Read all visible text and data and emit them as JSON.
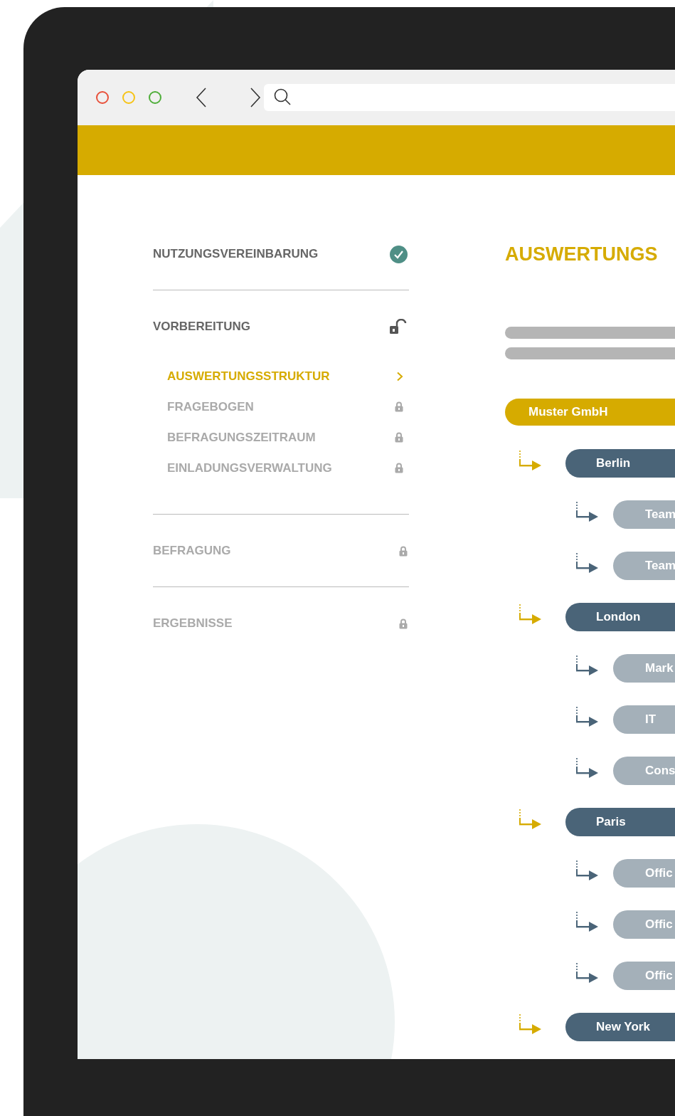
{
  "sidebar": {
    "sections": [
      {
        "label": "NUTZUNGSVEREINBARUNG",
        "kind": "done"
      },
      {
        "label": "VORBEREITUNG",
        "kind": "open",
        "items": [
          {
            "label": "AUSWERTUNGSSTRUKTUR",
            "selected": true,
            "locked": false
          },
          {
            "label": "FRAGEBOGEN",
            "selected": false,
            "locked": true
          },
          {
            "label": "BEFRAGUNGSZEITRAUM",
            "selected": false,
            "locked": true
          },
          {
            "label": "EINLADUNGSVERWALTUNG",
            "selected": false,
            "locked": true
          }
        ]
      },
      {
        "label": "BEFRAGUNG",
        "kind": "locked"
      },
      {
        "label": "ERGEBNISSE",
        "kind": "locked"
      }
    ]
  },
  "content": {
    "title": "AUSWERTUNGS",
    "tree": {
      "label": "Muster GmbH",
      "children": [
        {
          "label": "Berlin",
          "children": [
            {
              "label": "Team"
            },
            {
              "label": "Team"
            }
          ]
        },
        {
          "label": "London",
          "children": [
            {
              "label": "Mark"
            },
            {
              "label": "IT"
            },
            {
              "label": "Cons"
            }
          ]
        },
        {
          "label": "Paris",
          "children": [
            {
              "label": "Offic"
            },
            {
              "label": "Offic"
            },
            {
              "label": "Offic"
            }
          ]
        },
        {
          "label": "New York"
        }
      ]
    }
  }
}
